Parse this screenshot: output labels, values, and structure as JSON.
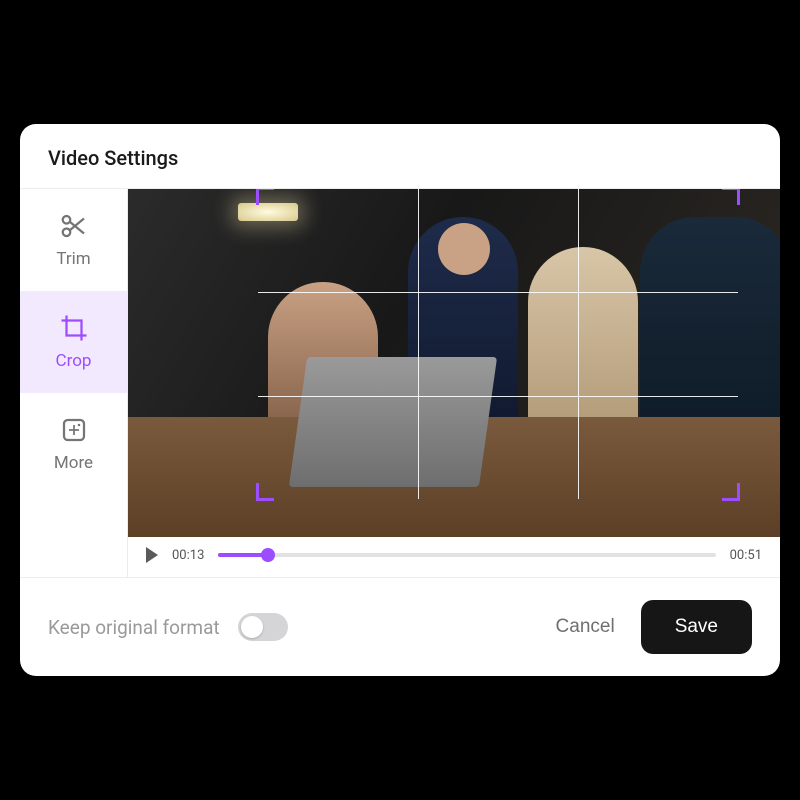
{
  "header": {
    "title": "Video Settings"
  },
  "sidebar": {
    "items": [
      {
        "label": "Trim"
      },
      {
        "label": "Crop"
      },
      {
        "label": "More"
      }
    ],
    "active_index": 1
  },
  "playback": {
    "current_time": "00:13",
    "total_time": "00:51",
    "progress_pct": 10
  },
  "footer": {
    "keep_format_label": "Keep original format",
    "keep_format_on": false,
    "cancel_label": "Cancel",
    "save_label": "Save"
  },
  "colors": {
    "accent": "#9b4dff",
    "panel_bg": "#ffffff",
    "text_muted": "#9a9a9a"
  }
}
